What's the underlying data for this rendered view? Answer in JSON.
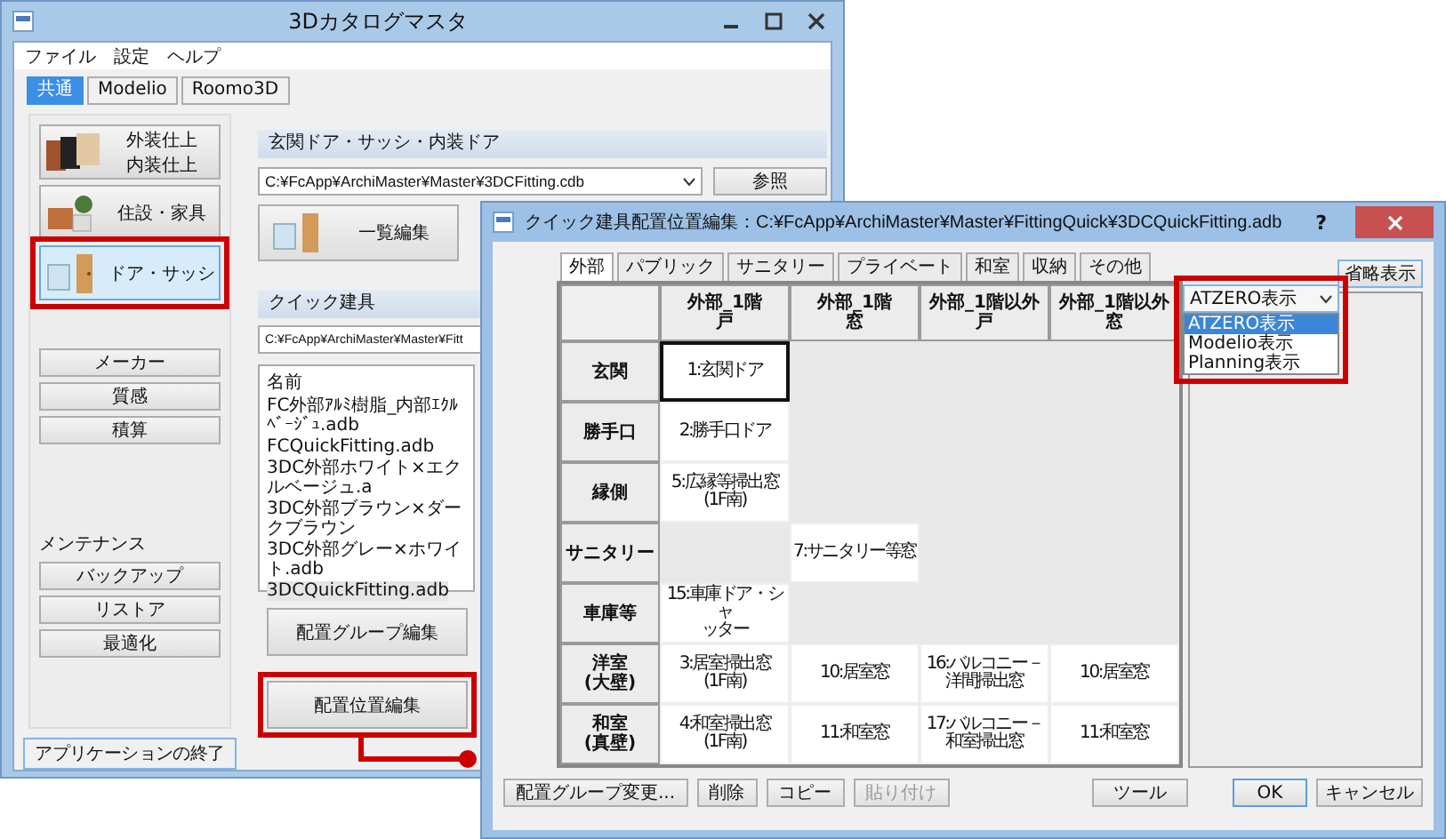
{
  "main_window": {
    "title": "3Dカタログマスタ",
    "menu": [
      "ファイル",
      "設定",
      "ヘルプ"
    ],
    "tabs": [
      {
        "label": "共通",
        "selected": true
      },
      {
        "label": "Modelio",
        "selected": false
      },
      {
        "label": "Roomo3D",
        "selected": false
      }
    ],
    "categories": [
      {
        "kind": "finish",
        "lines": [
          "外装仕上",
          "内装仕上"
        ],
        "selected": false,
        "callout": false
      },
      {
        "kind": "furniture",
        "lines": [
          "住設・家具"
        ],
        "selected": false,
        "callout": false
      },
      {
        "kind": "door",
        "lines": [
          "ドア・サッシ"
        ],
        "selected": true,
        "callout": true
      }
    ],
    "tools": [
      "メーカー",
      "質感",
      "積算"
    ],
    "maintenance": {
      "label": "メンテナンス",
      "buttons": [
        "バックアップ",
        "リストア",
        "最適化"
      ]
    },
    "exit_button": "アプリケーションの終了",
    "door_section": {
      "header": "玄関ドア・サッシ・内装ドア",
      "path": "C:¥FcApp¥ArchiMaster¥Master¥3DCFitting.cdb",
      "browse_button": "参照",
      "edit_button": "一覧編集"
    },
    "quick_section": {
      "header": "クイック建具",
      "path": "C:¥FcApp¥ArchiMaster¥Master¥Fitt",
      "list_header": "名前",
      "files": [
        {
          "name": "FC外部ｱﾙﾐ樹脂_内部ｴｸﾙﾍﾞｰｼﾞｭ.adb",
          "selected": false
        },
        {
          "name": "FCQuickFitting.adb",
          "selected": false
        },
        {
          "name": "3DC外部ホワイト×エクルベージュ.a",
          "selected": false
        },
        {
          "name": "3DC外部ブラウン×ダークブラウン",
          "selected": false
        },
        {
          "name": "3DC外部グレー×ホワイト.adb",
          "selected": false
        },
        {
          "name": "3DCQuickFitting.adb",
          "selected": true
        }
      ],
      "buttons": [
        {
          "label": "配置グループ編集",
          "callout": false
        },
        {
          "label": "配置位置編集",
          "callout": true
        }
      ]
    }
  },
  "dialog": {
    "title": "クイック建具配置位置編集：C:¥FcApp¥ArchiMaster¥Master¥FittingQuick¥3DCQuickFitting.adb",
    "help": "?",
    "tabs": [
      {
        "label": "外部",
        "selected": true
      },
      {
        "label": "パブリック",
        "selected": false
      },
      {
        "label": "サニタリー",
        "selected": false
      },
      {
        "label": "プライベート",
        "selected": false
      },
      {
        "label": "和室",
        "selected": false
      },
      {
        "label": "収納",
        "selected": false
      },
      {
        "label": "その他",
        "selected": false
      }
    ],
    "columns": [
      {
        "lines": [
          "外部_1階",
          "戸"
        ]
      },
      {
        "lines": [
          "外部_1階",
          "窓"
        ]
      },
      {
        "lines": [
          "外部_1階以外",
          "戸"
        ]
      },
      {
        "lines": [
          "外部_1階以外",
          "窓"
        ]
      }
    ],
    "rows": [
      {
        "header": [
          "玄関"
        ],
        "cells": [
          {
            "lines": [
              "1:玄関ドア"
            ],
            "selected": true
          },
          null,
          null,
          null
        ]
      },
      {
        "header": [
          "勝手口"
        ],
        "cells": [
          {
            "lines": [
              "2:勝手口ドア"
            ],
            "selected": false
          },
          null,
          null,
          null
        ]
      },
      {
        "header": [
          "縁側"
        ],
        "cells": [
          {
            "lines": [
              "5:広縁等掃出窓",
              "(1F南)"
            ],
            "selected": false
          },
          null,
          null,
          null
        ]
      },
      {
        "header": [
          "サニタリー"
        ],
        "cells": [
          null,
          {
            "lines": [
              "7:サニタリー等窓"
            ],
            "selected": false
          },
          null,
          null
        ]
      },
      {
        "header": [
          "車庫等"
        ],
        "cells": [
          {
            "lines": [
              "15:車庫ドア・シャ",
              "ッター"
            ],
            "selected": false
          },
          null,
          null,
          null
        ]
      },
      {
        "header": [
          "洋室",
          "(大壁)"
        ],
        "cells": [
          {
            "lines": [
              "3:居室掃出窓",
              "(1F南)"
            ],
            "selected": false
          },
          {
            "lines": [
              "10:居室窓"
            ],
            "selected": false
          },
          {
            "lines": [
              "16:バルコニー－",
              "洋間掃出窓"
            ],
            "selected": false
          },
          {
            "lines": [
              "10:居室窓"
            ],
            "selected": false
          }
        ]
      },
      {
        "header": [
          "和室",
          "(真壁)"
        ],
        "cells": [
          {
            "lines": [
              "4:和室掃出窓",
              "(1F南)"
            ],
            "selected": false
          },
          {
            "lines": [
              "11:和室窓"
            ],
            "selected": false
          },
          {
            "lines": [
              "17:バルコニー－",
              "和室掃出窓"
            ],
            "selected": false
          },
          {
            "lines": [
              "11:和室窓"
            ],
            "selected": false
          }
        ]
      }
    ],
    "display_select": {
      "value": "ATZERO表示",
      "expanded": true,
      "callout": true,
      "options": [
        {
          "label": "ATZERO表示",
          "selected": true
        },
        {
          "label": "Modelio表示",
          "selected": false
        },
        {
          "label": "Planning表示",
          "selected": false
        }
      ]
    },
    "abbrev_button": "省略表示",
    "bottom_buttons": [
      {
        "label": "配置グループ変更...",
        "disabled": false
      },
      {
        "label": "削除",
        "disabled": false
      },
      {
        "label": "コピー",
        "disabled": false
      },
      {
        "label": "貼り付け",
        "disabled": true
      }
    ],
    "tool_button": "ツール",
    "ok_button": "OK",
    "cancel_button": "キャンセル"
  }
}
